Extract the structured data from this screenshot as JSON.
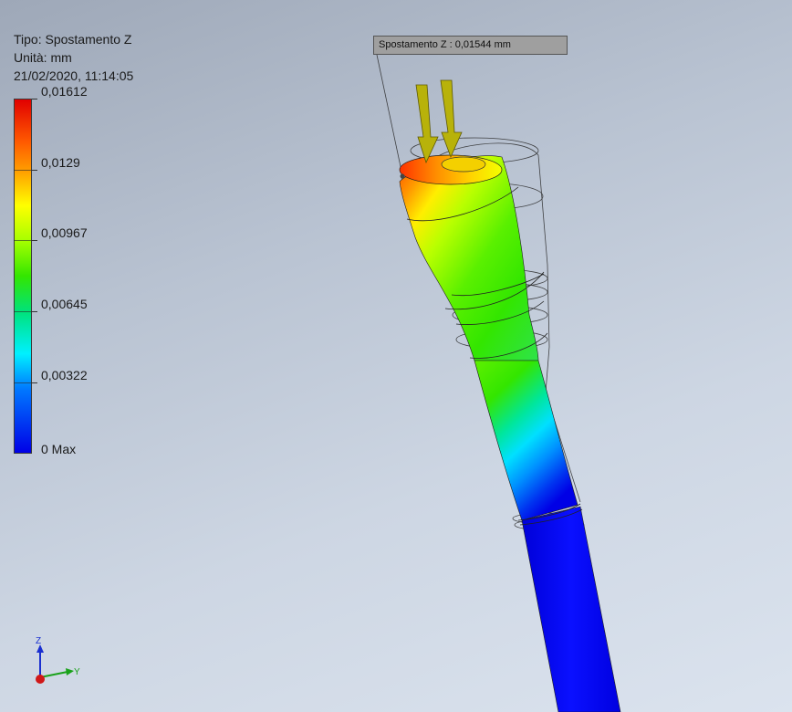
{
  "legend": {
    "type_line": "Tipo: Spostamento Z",
    "unit_line": "Unità: mm",
    "timestamp": "21/02/2020, 11:14:05",
    "labels": [
      "0,01612",
      "0,0129",
      "0,00967",
      "0,00645",
      "0,00322",
      "0 Max"
    ]
  },
  "probe": {
    "label": "Spostamento Z : 0,01544 mm"
  },
  "triad": {
    "z": "Z",
    "y": "Y"
  },
  "colors": {
    "max_red": "#e10000",
    "min_blue": "#0000e6",
    "arrow": "#b8b20a"
  }
}
